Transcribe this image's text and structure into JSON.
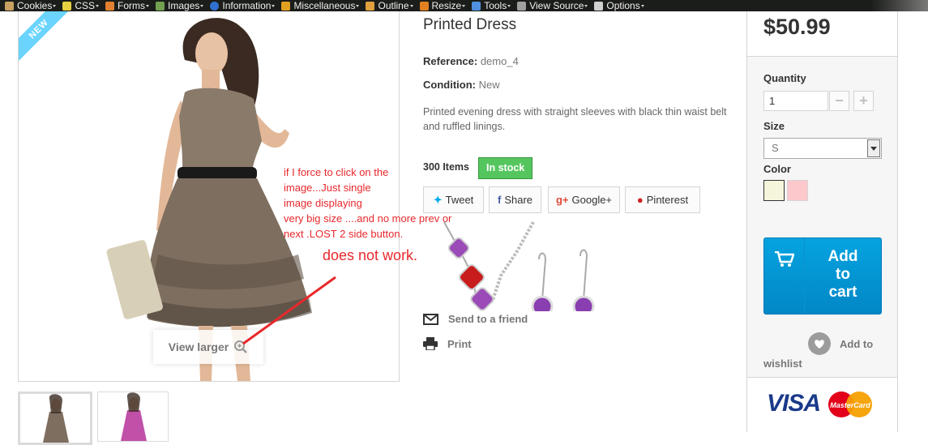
{
  "toolbar": {
    "items": [
      {
        "label": "Cookies",
        "color": "#c8a060"
      },
      {
        "label": "CSS",
        "color": "#e8d040"
      },
      {
        "label": "Forms",
        "color": "#e08030"
      },
      {
        "label": "Images",
        "color": "#70a050"
      },
      {
        "label": "Information",
        "color": "#3070d0"
      },
      {
        "label": "Miscellaneous",
        "color": "#e0a020"
      },
      {
        "label": "Outline",
        "color": "#e0a040"
      },
      {
        "label": "Resize",
        "color": "#e08020"
      },
      {
        "label": "Tools",
        "color": "#5090e0"
      },
      {
        "label": "View Source",
        "color": "#a0a0a0"
      },
      {
        "label": "Options",
        "color": "#d0d0d0"
      }
    ]
  },
  "product": {
    "ribbon": "NEW",
    "view_larger": "View larger",
    "title": "Printed Dress",
    "reference_label": "Reference:",
    "reference_value": "demo_4",
    "condition_label": "Condition:",
    "condition_value": "New",
    "description": "Printed evening dress with straight sleeves with black thin waist belt and ruffled linings.",
    "quantity_text": "300 Items",
    "stock_label": "In stock",
    "social": {
      "tweet": "Tweet",
      "share": "Share",
      "google": "Google+",
      "pinterest": "Pinterest"
    },
    "send_friend": "Send to a friend",
    "print": "Print"
  },
  "annotation": {
    "lines": [
      "if I force to click on the",
      "image...Just single",
      "image displaying",
      "very big size ....and no more prev or",
      "next .LOST 2 side button."
    ],
    "big_note": "does not  work."
  },
  "buy": {
    "price": "$50.99",
    "quantity_label": "Quantity",
    "quantity_value": "1",
    "minus": "−",
    "plus": "+",
    "size_label": "Size",
    "size_value": "S",
    "color_label": "Color",
    "colors": [
      "#f5f5dc",
      "#fcc8cc"
    ],
    "add_to_cart": [
      "Add",
      "to",
      "cart"
    ],
    "wishlist_1": "Add to",
    "wishlist_2": "wishlist",
    "visa": "VISA",
    "mastercard": "MasterCard"
  }
}
